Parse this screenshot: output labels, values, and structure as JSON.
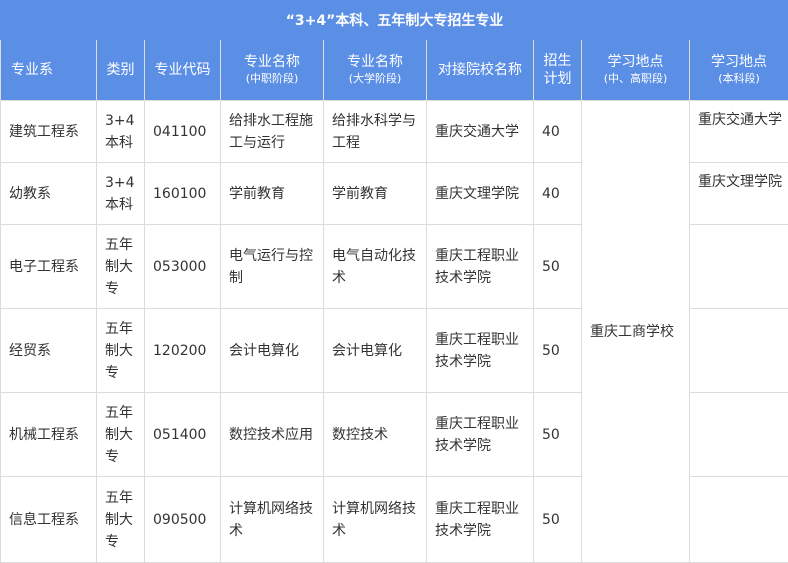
{
  "title": "“3+4”本科、五年制大专招生专业",
  "headers": [
    {
      "main": "专业系",
      "sub": ""
    },
    {
      "main": "类别",
      "sub": ""
    },
    {
      "main": "专业代码",
      "sub": ""
    },
    {
      "main": "专业名称",
      "sub": "(中职阶段)"
    },
    {
      "main": "专业名称",
      "sub": "(大学阶段)"
    },
    {
      "main": "对接院校名称",
      "sub": ""
    },
    {
      "main": "招生计划",
      "sub": ""
    },
    {
      "main": "学习地点",
      "sub": "(中、高职段)"
    },
    {
      "main": "学习地点",
      "sub": "(本科段)"
    }
  ],
  "shared_location": "重庆工商学校",
  "rows": [
    {
      "dept": "建筑工程系",
      "category": "3+4本科",
      "code": "041100",
      "major_secondary": "给排水工程施工与运行",
      "major_university": "给排水科学与工程",
      "partner": "重庆交通大学",
      "plan": "40",
      "location_undergrad": "重庆交通大学"
    },
    {
      "dept": "幼教系",
      "category": "3+4本科",
      "code": "160100",
      "major_secondary": "学前教育",
      "major_university": "学前教育",
      "partner": "重庆文理学院",
      "plan": "40",
      "location_undergrad": "重庆文理学院"
    },
    {
      "dept": "电子工程系",
      "category": "五年制大专",
      "code": "053000",
      "major_secondary": "电气运行与控制",
      "major_university": "电气自动化技术",
      "partner": "重庆工程职业技术学院",
      "plan": "50",
      "location_undergrad": ""
    },
    {
      "dept": "经贸系",
      "category": "五年制大专",
      "code": "120200",
      "major_secondary": "会计电算化",
      "major_university": "会计电算化",
      "partner": "重庆工程职业技术学院",
      "plan": "50",
      "location_undergrad": ""
    },
    {
      "dept": "机械工程系",
      "category": "五年制大专",
      "code": "051400",
      "major_secondary": "数控技术应用",
      "major_university": "数控技术",
      "partner": "重庆工程职业技术学院",
      "plan": "50",
      "location_undergrad": ""
    },
    {
      "dept": "信息工程系",
      "category": "五年制大专",
      "code": "090500",
      "major_secondary": "计算机网络技术",
      "major_university": "计算机网络技术",
      "partner": "重庆工程职业技术学院",
      "plan": "50",
      "location_undergrad": ""
    }
  ],
  "colors": {
    "header_bg": "#5b8fe6",
    "header_text": "#ffffff",
    "border": "#dcdcdc",
    "body_text": "#333333"
  }
}
